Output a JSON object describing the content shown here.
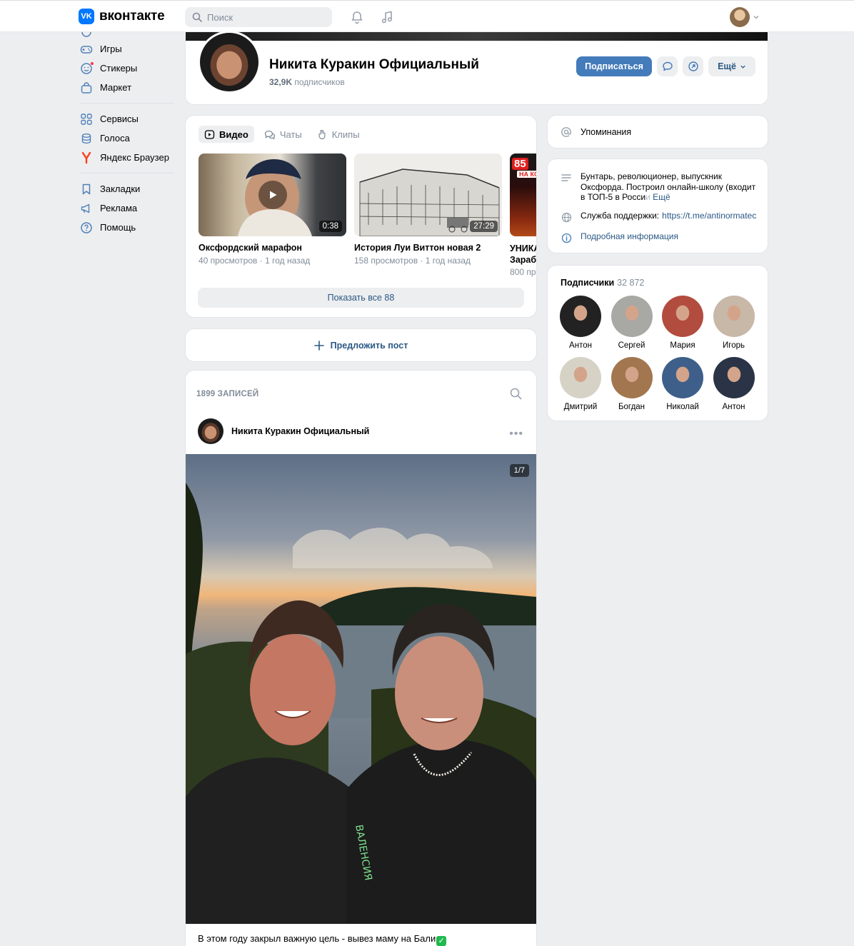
{
  "header": {
    "logo_mark": "VK",
    "logo_text": "вконтакте",
    "search_placeholder": "Поиск"
  },
  "leftnav": {
    "items": [
      {
        "label": "Игры",
        "icon": "gamepad-icon"
      },
      {
        "label": "Стикеры",
        "icon": "sticker-icon"
      },
      {
        "label": "Маркет",
        "icon": "bag-icon"
      },
      {
        "label": "Сервисы",
        "icon": "grid-icon"
      },
      {
        "label": "Голоса",
        "icon": "coins-icon"
      },
      {
        "label": "Яндекс Браузер",
        "icon": "yandex-icon"
      },
      {
        "label": "Закладки",
        "icon": "bookmark-icon"
      },
      {
        "label": "Реклама",
        "icon": "megaphone-icon"
      },
      {
        "label": "Помощь",
        "icon": "help-icon"
      }
    ]
  },
  "profile": {
    "name": "Никита Куракин Официальный",
    "subs_count": "32,9K",
    "subs_label": "подписчиков",
    "subscribe_label": "Подписаться",
    "more_label": "Ещё"
  },
  "videos": {
    "tabs": [
      "Видео",
      "Чаты",
      "Клипы"
    ],
    "items": [
      {
        "title": "Оксфордский марафон",
        "meta": "40 просмотров · 1 год назад",
        "duration": "0:38"
      },
      {
        "title": "История Луи Виттон новая 2",
        "meta": "158 просмотров · 1 год назад",
        "duration": "27:29"
      },
      {
        "title": "УНИКА",
        "title2": "Зараб",
        "meta": "800 пр",
        "badge": "85",
        "badge2": "НА КО"
      }
    ],
    "show_all": "Показать все 88"
  },
  "suggest": {
    "label": "Предложить пост"
  },
  "wall": {
    "count": "1899 ЗАПИСЕЙ",
    "post": {
      "author": "Никита Куракин Официальный",
      "counter": "1/7",
      "text": "В этом году закрыл важную цель - вывез маму на Бали"
    }
  },
  "mentions": {
    "label": "Упоминания"
  },
  "info": {
    "about_l1": "Бунтарь, революционер, выпускник",
    "about_l2": "Оксфорда. Построил онлайн-школу (входит",
    "about_l3": "в ТОП-5 в Росси",
    "about_fade": "и",
    "about_more": "Ещё",
    "support_label": "Служба поддержки:",
    "support_link": "https://t.me/antinormatec",
    "details": "Подробная информация"
  },
  "subscribers": {
    "title": "Подписчики",
    "count": "32 872",
    "people": [
      {
        "name": "Антон",
        "color": "#222"
      },
      {
        "name": "Сергей",
        "color": "#a8a8a4"
      },
      {
        "name": "Мария",
        "color": "#b24c3f"
      },
      {
        "name": "Игорь",
        "color": "#c8b8a8"
      },
      {
        "name": "Дмитрий",
        "color": "#d6d2c6"
      },
      {
        "name": "Богдан",
        "color": "#a2764e"
      },
      {
        "name": "Николай",
        "color": "#3e5f8a"
      },
      {
        "name": "Антон",
        "color": "#2a3446"
      }
    ]
  },
  "colors": {
    "accent": "#447bba",
    "link": "#2a5885",
    "muted": "#818c99",
    "bg": "#edeef0"
  }
}
